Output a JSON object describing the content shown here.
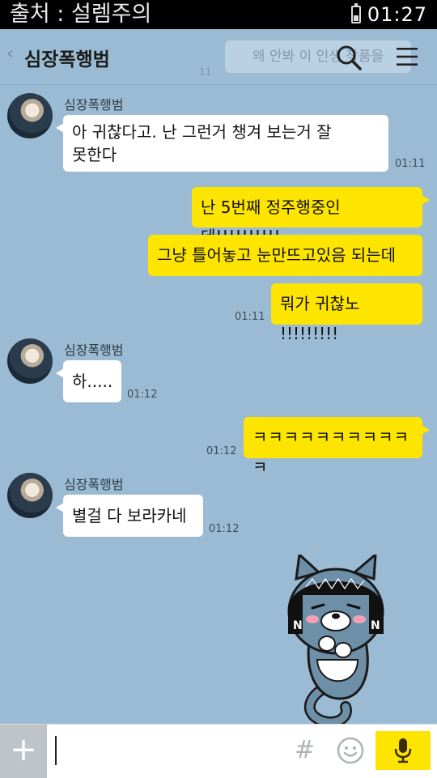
{
  "status_bar": {
    "source_text": "출처 : 설렘주의",
    "time": "01:27"
  },
  "header": {
    "back_icon": "chevron-left-icon",
    "room_title": "심장폭행범",
    "ghost_notice": "왜 안봐 이 인생 작품을",
    "ghost_count": "11"
  },
  "messages": [
    {
      "sender": "심장폭행범",
      "text_line1": "아 귀찮다고. 난 그런거 챙겨 보는거 잘",
      "text_line2": "못한다",
      "time": "01:11"
    },
    {
      "text": "난 5번째 정주행중인데!!!!!!!!!!"
    },
    {
      "text": "그냥 틀어놓고 눈만뜨고있음 되는데"
    },
    {
      "text": "뭐가 귀찮노 !!!!!!!!!",
      "time": "01:11"
    },
    {
      "sender": "심장폭행범",
      "text": "하.....",
      "time": "01:12"
    },
    {
      "text": "ㅋㅋㅋㅋㅋㅋㅋㅋㅋㅋㅋ",
      "time": "01:12"
    },
    {
      "sender": "심장폭행범",
      "text": "별걸 다 보라카네",
      "time": "01:12"
    }
  ],
  "sticker": {
    "icon": "cat-neo-sticker",
    "label": "N"
  },
  "input_bar": {
    "plus_label": "+",
    "hash_label": "#",
    "placeholder": ""
  },
  "colors": {
    "background": "#9bbbd4",
    "my_bubble": "#fee500",
    "their_bubble": "#ffffff"
  }
}
